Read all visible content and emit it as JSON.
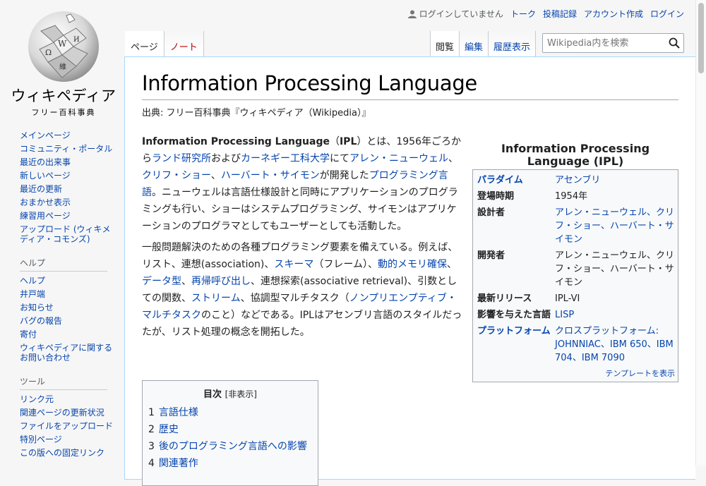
{
  "logo": {
    "wordmark": "ウィキペディア",
    "tagline": "フリー百科事典"
  },
  "personal": {
    "not_logged_in": "ログインしていません",
    "links": [
      "トーク",
      "投稿記録",
      "アカウント作成",
      "ログイン"
    ]
  },
  "tabs": {
    "left": [
      "ページ",
      "ノート"
    ],
    "right": [
      "閲覧",
      "編集",
      "履歴表示"
    ]
  },
  "search": {
    "placeholder": "Wikipedia内を検索"
  },
  "sidebar": {
    "nav": [
      "メインページ",
      "コミュニティ・ポータル",
      "最近の出来事",
      "新しいページ",
      "最近の更新",
      "おまかせ表示",
      "練習用ページ",
      "アップロード (ウィキメディア・コモンズ)"
    ],
    "help_heading": "ヘルプ",
    "help": [
      "ヘルプ",
      "井戸端",
      "お知らせ",
      "バグの報告",
      "寄付",
      "ウィキペディアに関するお問い合わせ"
    ],
    "tools_heading": "ツール",
    "tools": [
      "リンク元",
      "関連ページの更新状況",
      "ファイルをアップロード",
      "特別ページ",
      "この版への固定リンク"
    ]
  },
  "article": {
    "title": "Information Processing Language",
    "site_sub": "出典: フリー百科事典『ウィキペディア（Wikipedia）』",
    "p1": {
      "bold1": "Information Processing Language",
      "t1": "（",
      "bold2": "IPL",
      "t2": "）とは、1956年ごろから",
      "l1": "ランド研究所",
      "t3": "および",
      "l2": "カーネギー工科大学",
      "t4": "にて",
      "l3": "アレン・ニューウェル",
      "t5": "、",
      "l4": "クリフ・ショー",
      "t6": "、",
      "l5": "ハーバート・サイモン",
      "t7": "が開発した",
      "l6": "プログラミング言語",
      "t8": "。ニューウェルは言語仕様設計と同時にアプリケーションのプログラミングも行い、ショーはシステムプログラミング、サイモンはアプリケーションのプログラマとしてもユーザーとしても活動した。"
    },
    "p2": {
      "t1": "一般問題解決のための各種プログラミング要素を備えている。例えば、リスト、連想(association)、",
      "l1": "スキーマ",
      "t2": "（フレーム）、",
      "l2": "動的メモリ確保",
      "t3": "、",
      "l3": "データ型",
      "t4": "、",
      "l4": "再帰呼び出し",
      "t5": "、連想探索(associative retrieval)、引数としての関数、",
      "l5": "ストリーム",
      "t6": "、協調型マルチタスク（",
      "l6": "ノンプリエンプティブ・マルチタスク",
      "t7": "のこと）などである。IPLはアセンブリ言語のスタイルだったが、リスト処理の概念を開拓した。"
    }
  },
  "toc": {
    "title": "目次",
    "toggle": "[非表示]",
    "items": [
      {
        "num": "1",
        "label": "言語仕様"
      },
      {
        "num": "2",
        "label": "歴史"
      },
      {
        "num": "3",
        "label": "後のプログラミング言語への影響"
      },
      {
        "num": "4",
        "label": "関連著作"
      }
    ]
  },
  "infobox": {
    "title": "Information Processing Language (IPL)",
    "rows": [
      {
        "label": "パラダイム",
        "value": "アセンブリ"
      },
      {
        "label": "登場時期",
        "value": "1954年"
      },
      {
        "label": "設計者",
        "value": "アレン・ニューウェル、クリフ・ショー、ハーバート・サイモン"
      },
      {
        "label": "開発者",
        "value": "アレン・ニューウェル、クリフ・ショー、ハーバート・サイモン"
      },
      {
        "label": "最新リリース",
        "value": "IPL-VI"
      },
      {
        "label": "影響を与えた言語",
        "value": "LISP"
      },
      {
        "label": "プラットフォーム",
        "value": "クロスプラットフォーム:",
        "value2": "JOHNNIAC、IBM 650、IBM 704、IBM 7090"
      }
    ],
    "footer": "テンプレートを表示"
  }
}
